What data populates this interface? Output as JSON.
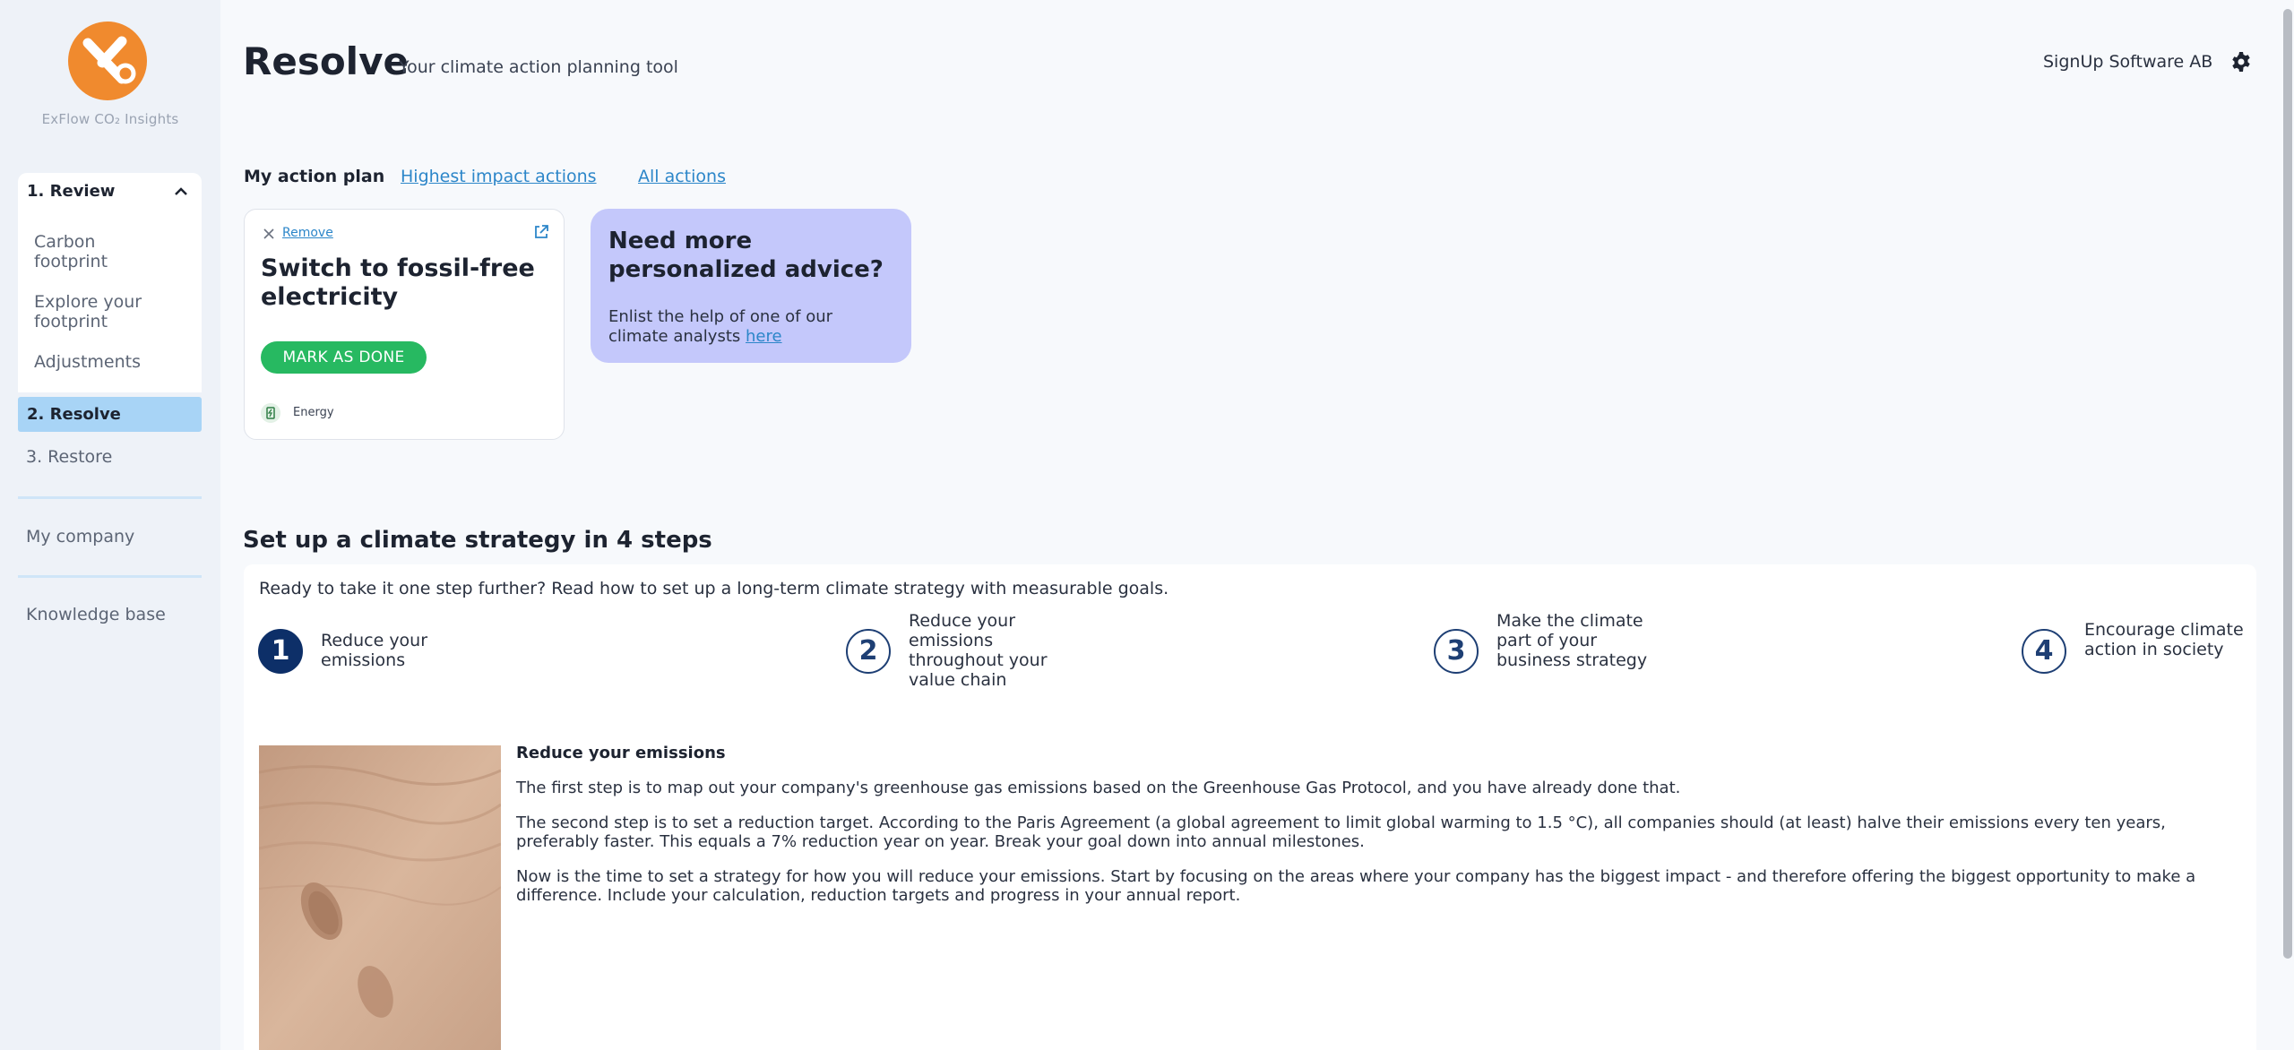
{
  "sidebar": {
    "brand": "ExFlow CO₂ Insights",
    "review_label": "1. Review",
    "review_items": [
      "Carbon footprint",
      "Explore your footprint",
      "Adjustments"
    ],
    "resolve_label": "2. Resolve",
    "restore_label": "3. Restore",
    "company_label": "My company",
    "knowledge_label": "Knowledge base"
  },
  "header": {
    "title": "Resolve",
    "subtitle": "Your climate action planning tool",
    "company": "SignUp Software AB"
  },
  "tabs": {
    "active": "My action plan",
    "highest_impact": "Highest impact actions",
    "all_actions": "All actions"
  },
  "action_card": {
    "remove_label": "Remove",
    "title": "Switch to fossil-free electricity",
    "mark_done_label": "MARK AS DONE",
    "category": "Energy"
  },
  "advice_card": {
    "title": "Need more personalized advice?",
    "text": "Enlist the help of one of our climate analysts",
    "link": "here"
  },
  "strategy": {
    "title": "Set up a climate strategy in 4 steps",
    "intro": "Ready to take it one step further? Read how to set up a long-term climate strategy with measurable goals.",
    "steps": [
      {
        "number": "1",
        "label": "Reduce your emissions"
      },
      {
        "number": "2",
        "label": "Reduce your emissions throughout your value chain"
      },
      {
        "number": "3",
        "label": "Make the climate part of your business strategy"
      },
      {
        "number": "4",
        "label": "Encourage climate action in society"
      }
    ],
    "detail_heading": "Reduce your emissions",
    "paragraphs": [
      "The first step is to map out your company's greenhouse gas emissions based on the Greenhouse Gas Protocol, and you have already done that.",
      "The second step is to set a reduction target. According to the Paris Agreement (a global agreement to limit global warming to 1.5 °C), all companies should (at least) halve their emissions every ten years, preferably faster. This equals a 7% reduction year on year. Break your goal down into annual milestones.",
      "Now is the time to set a strategy for how you will reduce your emissions. Start by focusing on the areas where your company has the biggest impact - and therefore offering the biggest opportunity to make a difference. Include your calculation, reduction targets and progress in your annual report."
    ]
  },
  "colors": {
    "accent_orange": "#f08a2e",
    "active_nav": "#a8d4f6",
    "link": "#2c86c9",
    "done_green": "#27b961",
    "advice_bg": "#c4c8fb",
    "step_navy": "#0d2f68"
  }
}
